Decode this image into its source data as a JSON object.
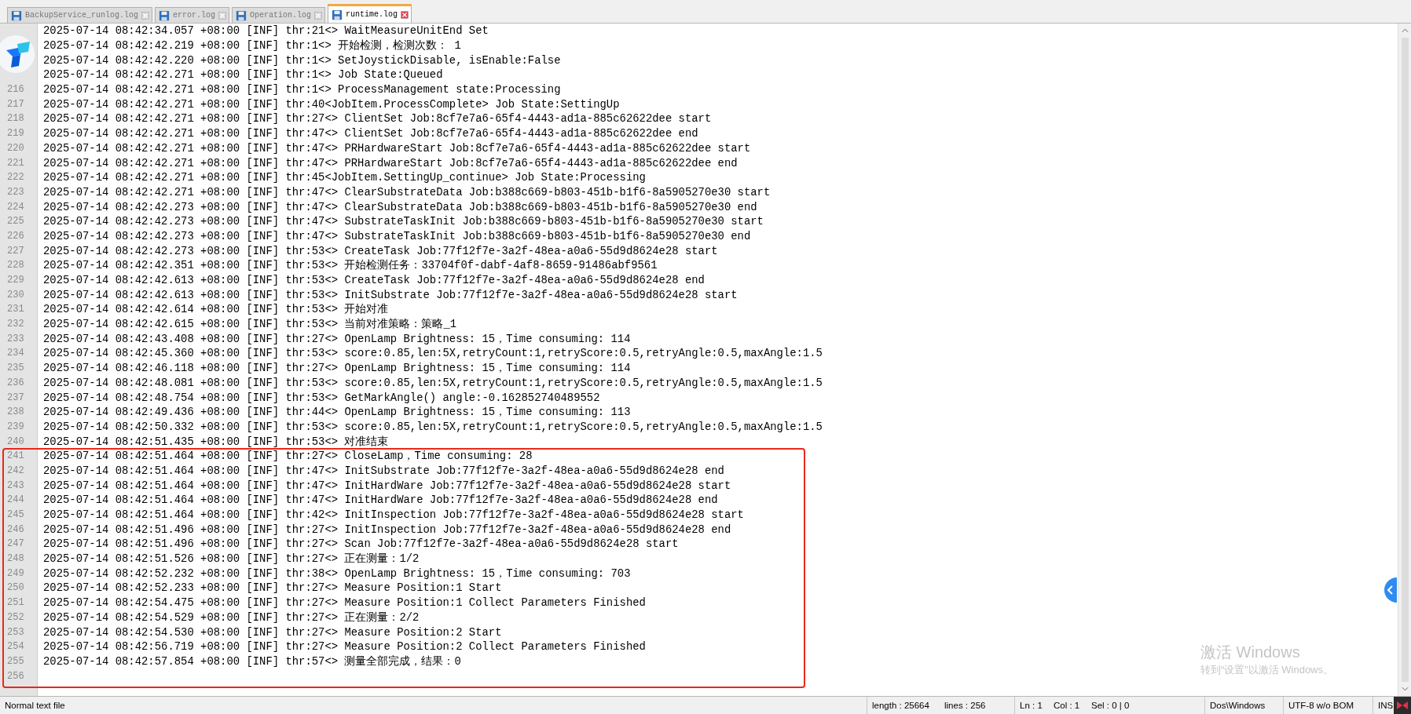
{
  "tabs": [
    {
      "label": "BackupService_runlog.log",
      "selected": false
    },
    {
      "label": "error.log",
      "selected": false
    },
    {
      "label": "Operation.log",
      "selected": false
    },
    {
      "label": "runtime.log",
      "selected": true
    }
  ],
  "lines": [
    {
      "text": "2025-07-14 08:42:34.057 +08:00 [INF] thr:21<> WaitMeasureUnitEnd Set"
    },
    {
      "text": "2025-07-14 08:42:42.219 +08:00 [INF] thr:1<> 开始检测，检测次数： 1"
    },
    {
      "text": "2025-07-14 08:42:42.220 +08:00 [INF] thr:1<> SetJoystickDisable, isEnable:False"
    },
    {
      "text": "2025-07-14 08:42:42.271 +08:00 [INF] thr:1<> Job State:Queued"
    },
    {
      "number": "216",
      "text": "2025-07-14 08:42:42.271 +08:00 [INF] thr:1<> ProcessManagement state:Processing"
    },
    {
      "number": "217",
      "text": "2025-07-14 08:42:42.271 +08:00 [INF] thr:40<JobItem.ProcessComplete> Job State:SettingUp"
    },
    {
      "number": "218",
      "text": "2025-07-14 08:42:42.271 +08:00 [INF] thr:27<> ClientSet Job:8cf7e7a6-65f4-4443-ad1a-885c62622dee start"
    },
    {
      "number": "219",
      "text": "2025-07-14 08:42:42.271 +08:00 [INF] thr:47<> ClientSet Job:8cf7e7a6-65f4-4443-ad1a-885c62622dee end"
    },
    {
      "number": "220",
      "text": "2025-07-14 08:42:42.271 +08:00 [INF] thr:47<> PRHardwareStart Job:8cf7e7a6-65f4-4443-ad1a-885c62622dee start"
    },
    {
      "number": "221",
      "text": "2025-07-14 08:42:42.271 +08:00 [INF] thr:47<> PRHardwareStart Job:8cf7e7a6-65f4-4443-ad1a-885c62622dee end"
    },
    {
      "number": "222",
      "text": "2025-07-14 08:42:42.271 +08:00 [INF] thr:45<JobItem.SettingUp_continue> Job State:Processing"
    },
    {
      "number": "223",
      "text": "2025-07-14 08:42:42.271 +08:00 [INF] thr:47<> ClearSubstrateData Job:b388c669-b803-451b-b1f6-8a5905270e30 start"
    },
    {
      "number": "224",
      "text": "2025-07-14 08:42:42.273 +08:00 [INF] thr:47<> ClearSubstrateData Job:b388c669-b803-451b-b1f6-8a5905270e30 end"
    },
    {
      "number": "225",
      "text": "2025-07-14 08:42:42.273 +08:00 [INF] thr:47<> SubstrateTaskInit Job:b388c669-b803-451b-b1f6-8a5905270e30 start"
    },
    {
      "number": "226",
      "text": "2025-07-14 08:42:42.273 +08:00 [INF] thr:47<> SubstrateTaskInit Job:b388c669-b803-451b-b1f6-8a5905270e30 end"
    },
    {
      "number": "227",
      "text": "2025-07-14 08:42:42.273 +08:00 [INF] thr:53<> CreateTask Job:77f12f7e-3a2f-48ea-a0a6-55d9d8624e28 start"
    },
    {
      "number": "228",
      "text": "2025-07-14 08:42:42.351 +08:00 [INF] thr:53<> 开始检测任务：33704f0f-dabf-4af8-8659-91486abf9561"
    },
    {
      "number": "229",
      "text": "2025-07-14 08:42:42.613 +08:00 [INF] thr:53<> CreateTask Job:77f12f7e-3a2f-48ea-a0a6-55d9d8624e28 end"
    },
    {
      "number": "230",
      "text": "2025-07-14 08:42:42.613 +08:00 [INF] thr:53<> InitSubstrate Job:77f12f7e-3a2f-48ea-a0a6-55d9d8624e28 start"
    },
    {
      "number": "231",
      "text": "2025-07-14 08:42:42.614 +08:00 [INF] thr:53<> 开始对准"
    },
    {
      "number": "232",
      "text": "2025-07-14 08:42:42.615 +08:00 [INF] thr:53<> 当前对准策略：策略_1"
    },
    {
      "number": "233",
      "text": "2025-07-14 08:42:43.408 +08:00 [INF] thr:27<> OpenLamp Brightness: 15，Time consuming: 114"
    },
    {
      "number": "234",
      "text": "2025-07-14 08:42:45.360 +08:00 [INF] thr:53<> score:0.85,len:5X,retryCount:1,retryScore:0.5,retryAngle:0.5,maxAngle:1.5"
    },
    {
      "number": "235",
      "text": "2025-07-14 08:42:46.118 +08:00 [INF] thr:27<> OpenLamp Brightness: 15，Time consuming: 114"
    },
    {
      "number": "236",
      "text": "2025-07-14 08:42:48.081 +08:00 [INF] thr:53<> score:0.85,len:5X,retryCount:1,retryScore:0.5,retryAngle:0.5,maxAngle:1.5"
    },
    {
      "number": "237",
      "text": "2025-07-14 08:42:48.754 +08:00 [INF] thr:53<> GetMarkAngle() angle:-0.162852740489552"
    },
    {
      "number": "238",
      "text": "2025-07-14 08:42:49.436 +08:00 [INF] thr:44<> OpenLamp Brightness: 15，Time consuming: 113"
    },
    {
      "number": "239",
      "text": "2025-07-14 08:42:50.332 +08:00 [INF] thr:53<> score:0.85,len:5X,retryCount:1,retryScore:0.5,retryAngle:0.5,maxAngle:1.5"
    },
    {
      "number": "240",
      "text": "2025-07-14 08:42:51.435 +08:00 [INF] thr:53<> 对准结束"
    }
  ],
  "highlighted_lines": [
    {
      "number": "241",
      "text": "2025-07-14 08:42:51.464 +08:00 [INF] thr:27<> CloseLamp，Time consuming: 28"
    },
    {
      "number": "242",
      "text": "2025-07-14 08:42:51.464 +08:00 [INF] thr:47<> InitSubstrate Job:77f12f7e-3a2f-48ea-a0a6-55d9d8624e28 end"
    },
    {
      "number": "243",
      "text": "2025-07-14 08:42:51.464 +08:00 [INF] thr:47<> InitHardWare Job:77f12f7e-3a2f-48ea-a0a6-55d9d8624e28 start"
    },
    {
      "number": "244",
      "text": "2025-07-14 08:42:51.464 +08:00 [INF] thr:47<> InitHardWare Job:77f12f7e-3a2f-48ea-a0a6-55d9d8624e28 end"
    },
    {
      "number": "245",
      "text": "2025-07-14 08:42:51.464 +08:00 [INF] thr:42<> InitInspection Job:77f12f7e-3a2f-48ea-a0a6-55d9d8624e28 start"
    },
    {
      "number": "246",
      "text": "2025-07-14 08:42:51.496 +08:00 [INF] thr:27<> InitInspection Job:77f12f7e-3a2f-48ea-a0a6-55d9d8624e28 end"
    },
    {
      "number": "247",
      "text": "2025-07-14 08:42:51.496 +08:00 [INF] thr:27<> Scan Job:77f12f7e-3a2f-48ea-a0a6-55d9d8624e28 start"
    },
    {
      "number": "248",
      "text": "2025-07-14 08:42:51.526 +08:00 [INF] thr:27<> 正在测量：1/2"
    },
    {
      "number": "249",
      "text": "2025-07-14 08:42:52.232 +08:00 [INF] thr:38<> OpenLamp Brightness: 15，Time consuming: 703"
    },
    {
      "number": "250",
      "text": "2025-07-14 08:42:52.233 +08:00 [INF] thr:27<> Measure Position:1 Start"
    },
    {
      "number": "251",
      "text": "2025-07-14 08:42:54.475 +08:00 [INF] thr:27<> Measure Position:1 Collect Parameters Finished"
    },
    {
      "number": "252",
      "text": "2025-07-14 08:42:54.529 +08:00 [INF] thr:27<> 正在测量：2/2"
    },
    {
      "number": "253",
      "text": "2025-07-14 08:42:54.530 +08:00 [INF] thr:27<> Measure Position:2 Start"
    },
    {
      "number": "254",
      "text": "2025-07-14 08:42:56.719 +08:00 [INF] thr:27<> Measure Position:2 Collect Parameters Finished"
    },
    {
      "number": "255",
      "text": "2025-07-14 08:42:57.854 +08:00 [INF] thr:57<> 测量全部完成，结果：0"
    },
    {
      "number": "256"
    }
  ],
  "activation_notice": {
    "title": "激活 Windows",
    "subtitle": "转到“设置”以激活 Windows。"
  },
  "status_bar": {
    "file_type": "Normal text file",
    "length": "length : 25664",
    "lines": "lines : 256",
    "ln": "Ln : 1",
    "col": "Col : 1",
    "sel": "Sel : 0 | 0",
    "eol": "Dos\\Windows",
    "encoding": "UTF-8 w/o BOM",
    "mode": "INS"
  }
}
